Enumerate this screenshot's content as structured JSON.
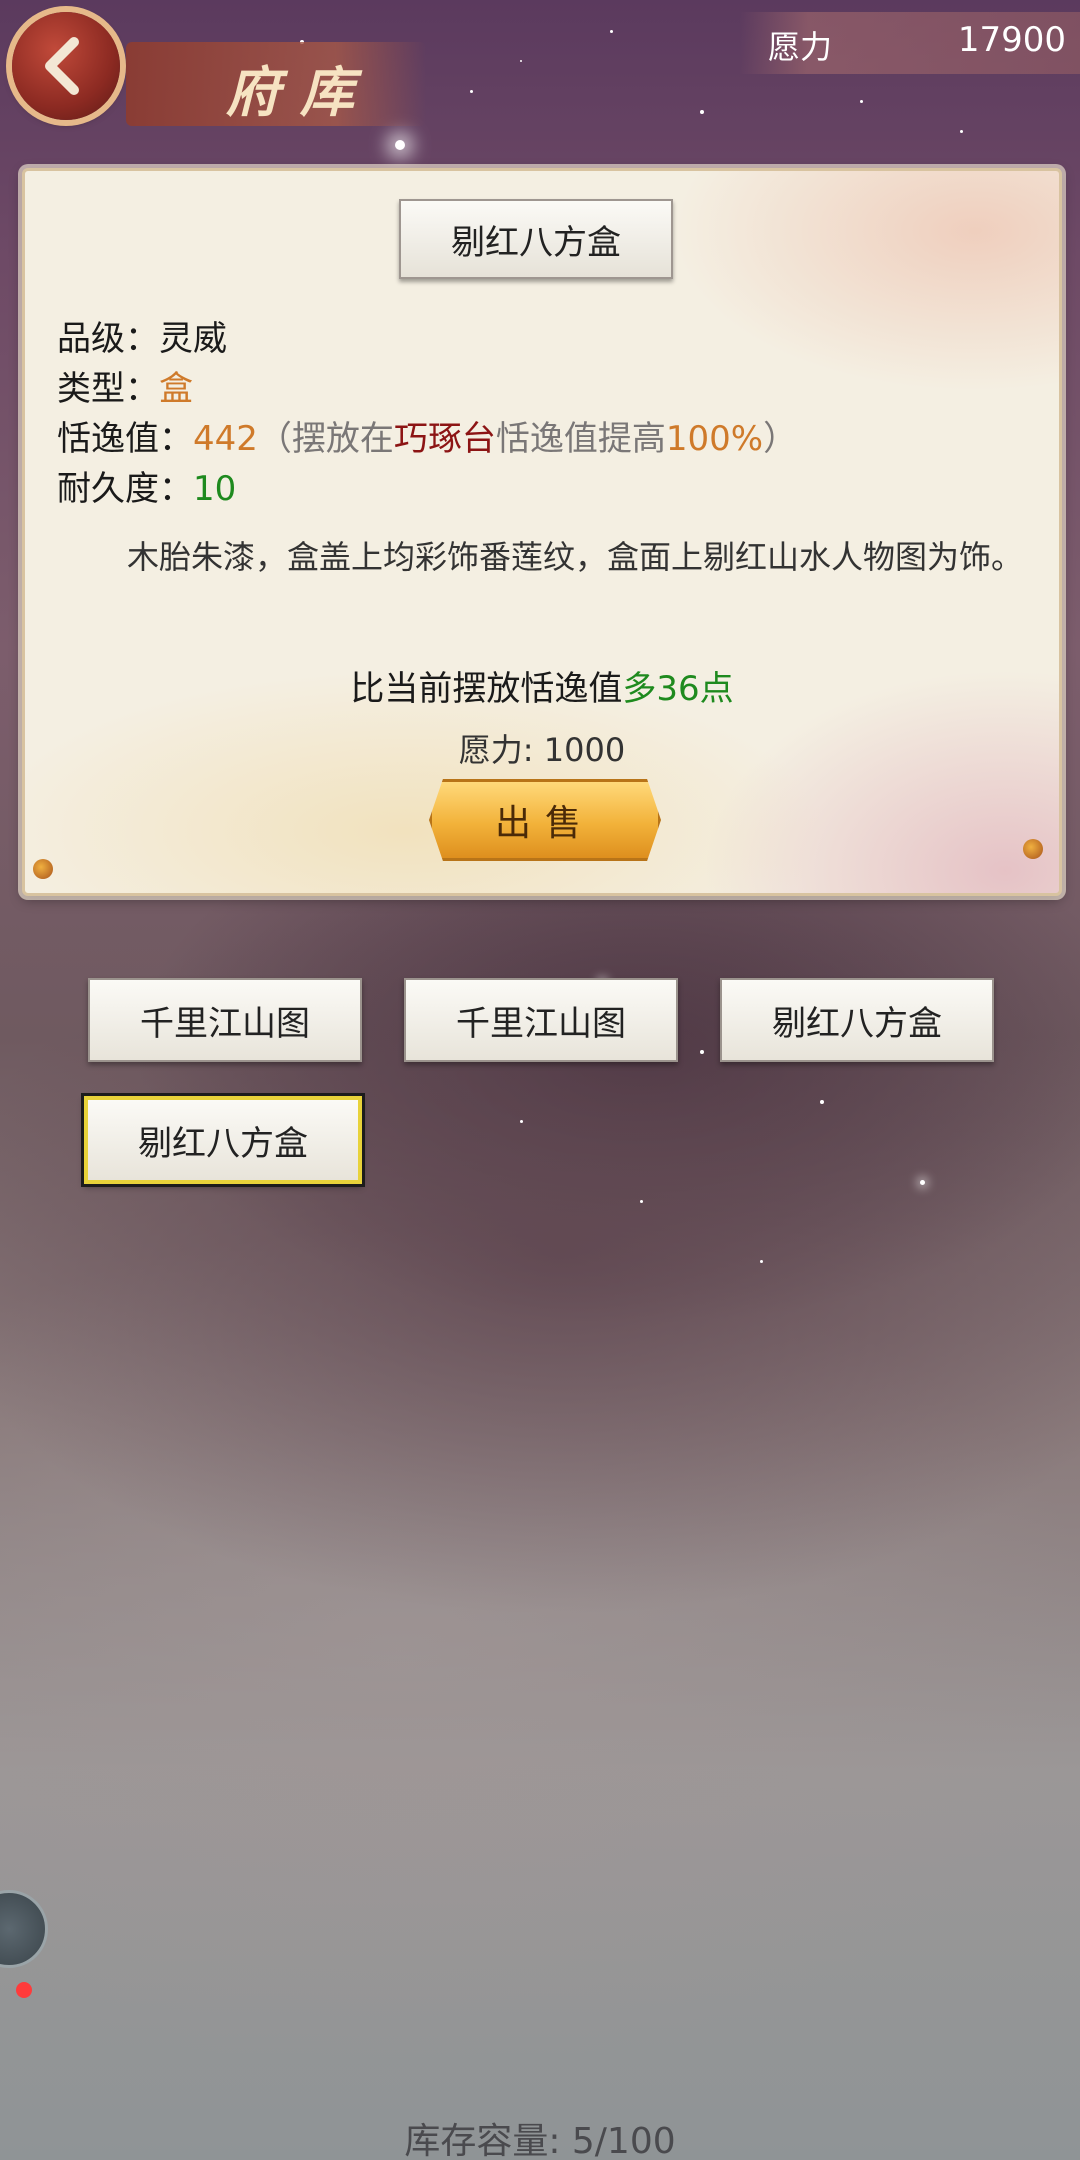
{
  "header": {
    "title": "府库",
    "resource_label": "愿力",
    "resource_value": "17900"
  },
  "detail": {
    "item_name": "剔红八方盒",
    "grade_label": "品级：",
    "grade_value": "灵威",
    "type_label": "类型：",
    "type_value": "盒",
    "leisure_label": "恬逸值：",
    "leisure_value": "442",
    "bonus_prefix": "（摆放在",
    "bonus_place": "巧琢台",
    "bonus_mid": "恬逸值提高",
    "bonus_percent": "100%",
    "bonus_suffix": "）",
    "durability_label": "耐久度：",
    "durability_value": "10",
    "description": "木胎朱漆，盒盖上均彩饰番莲纹，盒面上剔红山水人物图为饰。",
    "compare_prefix": "比当前摆放恬逸值",
    "compare_value": "多36点",
    "cost_text": "愿力: 1000",
    "sell_label": "出售"
  },
  "inventory": {
    "items": [
      {
        "label": "千里江山图",
        "selected": false
      },
      {
        "label": "千里江山图",
        "selected": false
      },
      {
        "label": "剔红八方盒",
        "selected": false
      },
      {
        "label": "剔红八方盒",
        "selected": true
      }
    ],
    "capacity_text": "库存容量: 5/100"
  },
  "colors": {
    "accent_orange": "#cf7a2a",
    "accent_green": "#1e8a1e",
    "accent_red": "#8c1414",
    "selected_border": "#e8d23a"
  }
}
